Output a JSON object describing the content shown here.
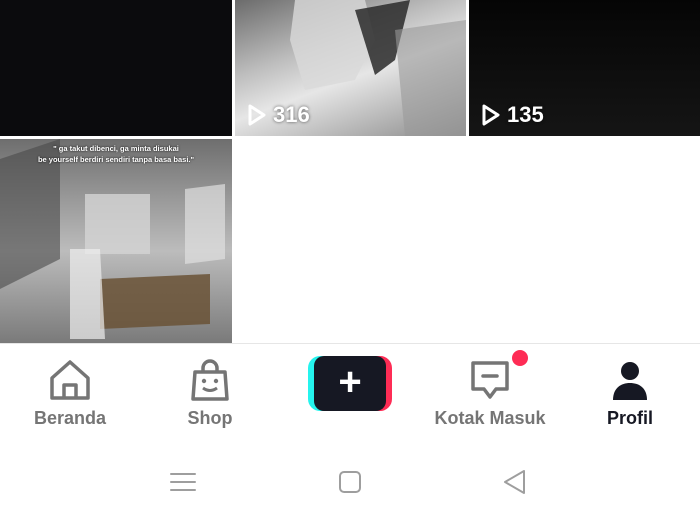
{
  "grid": {
    "videos": [
      {
        "views": ""
      },
      {
        "views": "316"
      },
      {
        "views": "135"
      },
      {
        "views": "",
        "caption_line1": "\" ga takut dibenci, ga minta disukai",
        "caption_line2": "be yourself berdiri sendiri tanpa basa basi.\""
      }
    ]
  },
  "bottom_nav": {
    "home_label": "Beranda",
    "shop_label": "Shop",
    "create_label": "+",
    "inbox_label": "Kotak Masuk",
    "profile_label": "Profil",
    "active": "Profil"
  },
  "colors": {
    "accent_red": "#fe2c55",
    "accent_cyan": "#25f4ee",
    "dark": "#161823",
    "inactive": "#757575"
  },
  "icons": {
    "home": "home-icon",
    "shop": "shopping-bag-icon",
    "inbox": "message-icon",
    "profile": "person-icon",
    "play": "play-icon",
    "sys_menu": "menu-icon",
    "sys_home": "square-icon",
    "sys_back": "back-triangle-icon"
  }
}
